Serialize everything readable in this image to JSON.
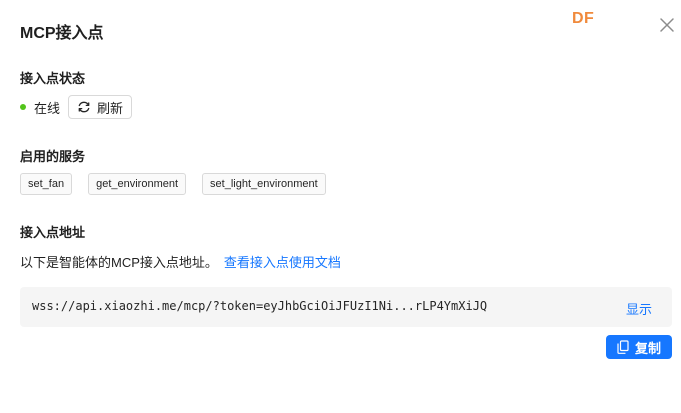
{
  "dialog": {
    "title": "MCP接入点",
    "logo_text": "DF",
    "close_icon": "close-icon"
  },
  "status_section": {
    "label": "接入点状态",
    "status_text": "在线",
    "status_color": "#52c41a",
    "refresh_label": "刷新",
    "refresh_icon": "refresh-icon"
  },
  "services_section": {
    "label": "启用的服务",
    "services": [
      "set_fan",
      "get_environment",
      "set_light_environment"
    ]
  },
  "address_section": {
    "label": "接入点地址",
    "description": "以下是智能体的MCP接入点地址。",
    "doc_link": "查看接入点使用文档",
    "url": "wss://api.xiaozhi.me/mcp/?token=eyJhbGciOiJFUzI1Ni...rLP4YmXiJQ",
    "show_label": "显示",
    "copy_label": "复制",
    "copy_icon": "copy-icon"
  },
  "colors": {
    "accent": "#1677ff",
    "logo": "#f08a3c"
  }
}
